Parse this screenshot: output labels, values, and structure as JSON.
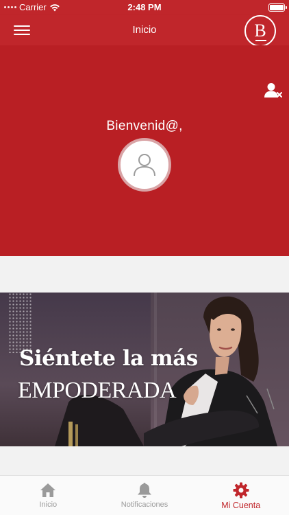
{
  "status_bar": {
    "carrier": "Carrier",
    "time": "2:48 PM"
  },
  "nav": {
    "title": "Inicio",
    "logo_letter": "B",
    "menu_icon": "hamburger-menu-icon"
  },
  "hero": {
    "welcome": "Bienvenid@,",
    "logout_icon": "user-remove-icon",
    "avatar_icon": "user-avatar-icon"
  },
  "banner": {
    "line1": "Siéntete la más",
    "line2": "EMPODERADA"
  },
  "tabs": [
    {
      "label": "Inicio",
      "icon": "home-icon",
      "active": false
    },
    {
      "label": "Notificaciones",
      "icon": "bell-icon",
      "active": false
    },
    {
      "label": "Mi Cuenta",
      "icon": "gear-icon",
      "active": true
    }
  ],
  "colors": {
    "brand_red": "#c0262b",
    "hero_red": "#b91f24",
    "inactive_gray": "#9a9a9a",
    "background": "#f2f2f2"
  }
}
